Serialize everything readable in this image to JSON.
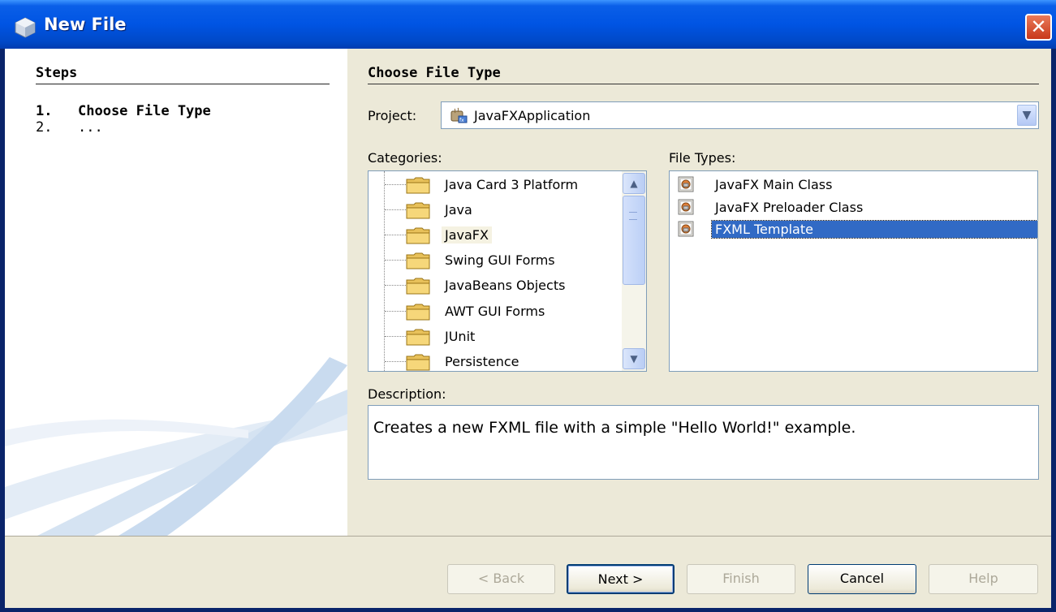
{
  "window": {
    "title": "New File",
    "close_symbol": "✕"
  },
  "steps": {
    "title": "Steps",
    "items": [
      {
        "num": "1.",
        "label": "Choose File Type"
      },
      {
        "num": "2.",
        "label": "..."
      }
    ]
  },
  "main": {
    "section_title": "Choose File Type",
    "project_label": "Project:",
    "project_value": "JavaFXApplication",
    "categories_label": "Categories:",
    "file_types_label": "File Types:",
    "categories": [
      "Java Card 3 Platform",
      "Java",
      "JavaFX",
      "Swing GUI Forms",
      "JavaBeans Objects",
      "AWT GUI Forms",
      "JUnit",
      "Persistence"
    ],
    "selected_category": "JavaFX",
    "file_types": [
      "JavaFX Main Class",
      "JavaFX Preloader Class",
      "FXML Template"
    ],
    "selected_file_type": "FXML Template",
    "description_label": "Description:",
    "description_text": "Creates a new FXML file with a simple \"Hello World!\" example."
  },
  "buttons": {
    "back": "< Back",
    "next": "Next >",
    "finish": "Finish",
    "cancel": "Cancel",
    "help": "Help"
  },
  "colors": {
    "titlebar": "#0054e3",
    "selection": "#316ac5",
    "dialog_bg": "#ece9d8"
  }
}
